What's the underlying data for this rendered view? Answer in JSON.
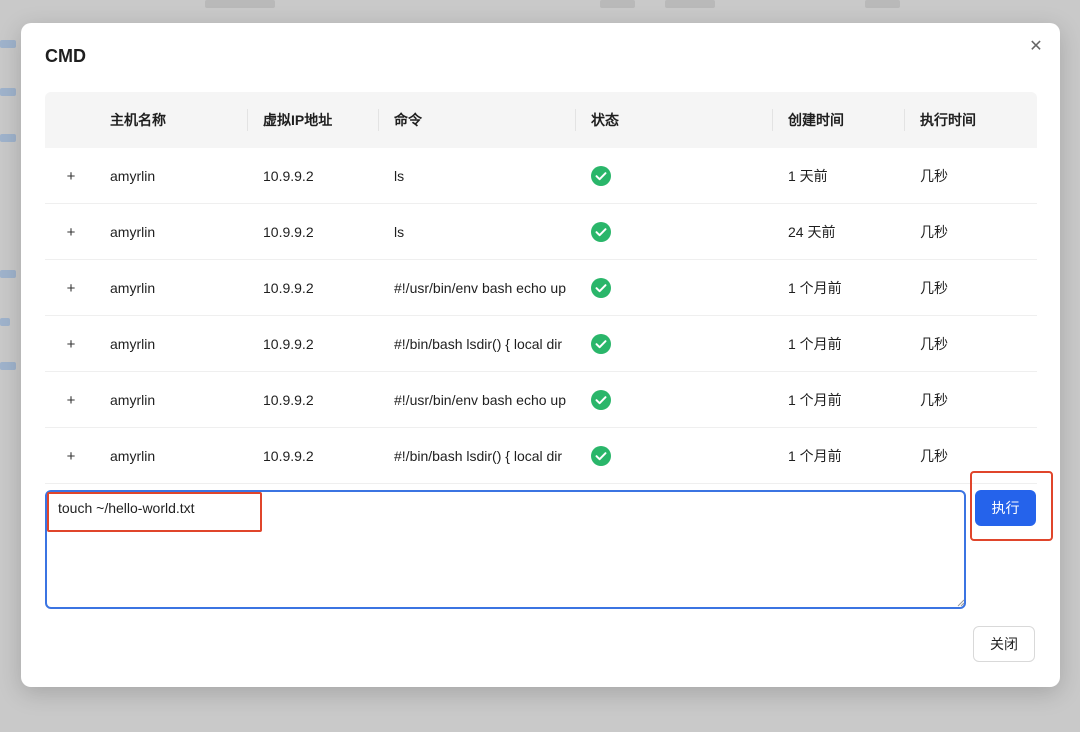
{
  "modal": {
    "title": "CMD",
    "close_icon": "close-icon"
  },
  "table": {
    "columns": [
      "主机名称",
      "虚拟IP地址",
      "命令",
      "状态",
      "创建时间",
      "执行时间"
    ],
    "rows": [
      {
        "host": "amyrlin",
        "ip": "10.9.9.2",
        "command": "ls",
        "status": "success",
        "created": "1 天前",
        "exec_time": "几秒"
      },
      {
        "host": "amyrlin",
        "ip": "10.9.9.2",
        "command": "ls",
        "status": "success",
        "created": "24 天前",
        "exec_time": "几秒"
      },
      {
        "host": "amyrlin",
        "ip": "10.9.9.2",
        "command": "#!/usr/bin/env bash echo up",
        "status": "success",
        "created": "1 个月前",
        "exec_time": "几秒"
      },
      {
        "host": "amyrlin",
        "ip": "10.9.9.2",
        "command": "#!/bin/bash lsdir() { local dir",
        "status": "success",
        "created": "1 个月前",
        "exec_time": "几秒"
      },
      {
        "host": "amyrlin",
        "ip": "10.9.9.2",
        "command": "#!/usr/bin/env bash echo up",
        "status": "success",
        "created": "1 个月前",
        "exec_time": "几秒"
      },
      {
        "host": "amyrlin",
        "ip": "10.9.9.2",
        "command": "#!/bin/bash lsdir() { local dir",
        "status": "success",
        "created": "1 个月前",
        "exec_time": "几秒"
      }
    ]
  },
  "command_input": {
    "value": "touch ~/hello-world.txt"
  },
  "buttons": {
    "execute": "执行",
    "close": "关闭"
  },
  "colors": {
    "primary": "#2563eb",
    "success": "#2ab66a",
    "annotation": "#e0452b"
  }
}
